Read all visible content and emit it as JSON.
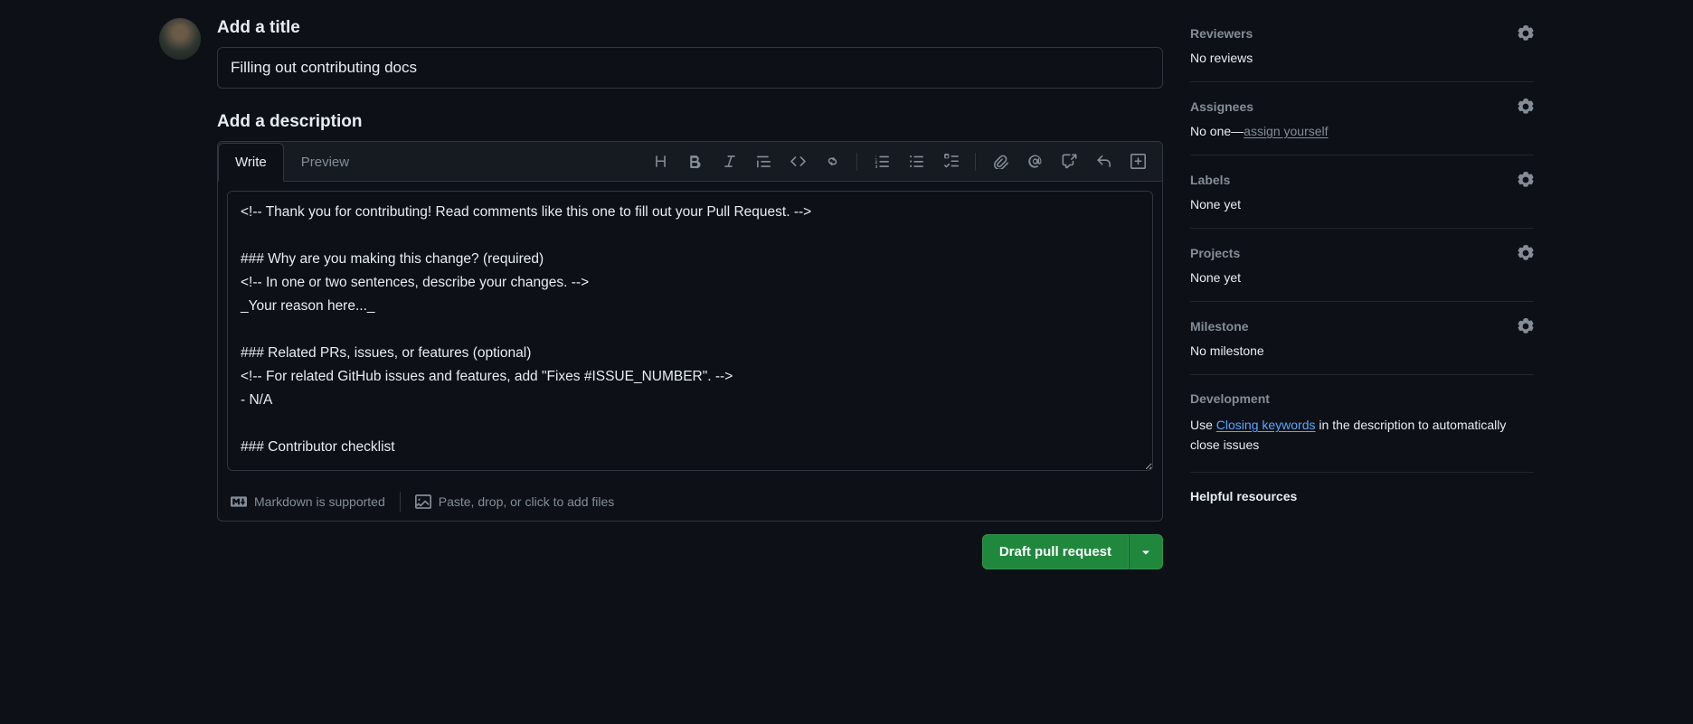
{
  "title_section_label": "Add a title",
  "title_value": "Filling out contributing docs",
  "description_section_label": "Add a description",
  "tabs": {
    "write": "Write",
    "preview": "Preview"
  },
  "toolbar_icons": {
    "heading": "heading-icon",
    "bold": "bold-icon",
    "italic": "italic-icon",
    "quote": "quote-icon",
    "code": "code-icon",
    "link": "link-icon",
    "ol": "ordered-list-icon",
    "ul": "unordered-list-icon",
    "tasklist": "task-list-icon",
    "attach": "paperclip-icon",
    "mention": "mention-icon",
    "reference": "cross-reference-icon",
    "reply": "reply-icon",
    "suggest": "diff-icon"
  },
  "description_value": "<!-- Thank you for contributing! Read comments like this one to fill out your Pull Request. -->\n\n### Why are you making this change? (required)\n<!-- In one or two sentences, describe your changes. -->\n_Your reason here..._\n\n### Related PRs, issues, or features (optional)\n<!-- For related GitHub issues and features, add \"Fixes #ISSUE_NUMBER\". -->\n- N/A\n\n### Contributor checklist",
  "footer": {
    "markdown": "Markdown is supported",
    "attach": "Paste, drop, or click to add files"
  },
  "submit_label": "Draft pull request",
  "sidebar": {
    "reviewers": {
      "title": "Reviewers",
      "body": "No reviews"
    },
    "assignees": {
      "title": "Assignees",
      "prefix": "No one—",
      "link": "assign yourself"
    },
    "labels": {
      "title": "Labels",
      "body": "None yet"
    },
    "projects": {
      "title": "Projects",
      "body": "None yet"
    },
    "milestone": {
      "title": "Milestone",
      "body": "No milestone"
    },
    "development": {
      "title": "Development",
      "prefix": "Use ",
      "link": "Closing keywords",
      "suffix": " in the description to automatically close issues"
    },
    "helpful": "Helpful resources"
  },
  "colors": {
    "accent": "#1f883d",
    "link": "#58a6ff",
    "border": "#30363d"
  }
}
